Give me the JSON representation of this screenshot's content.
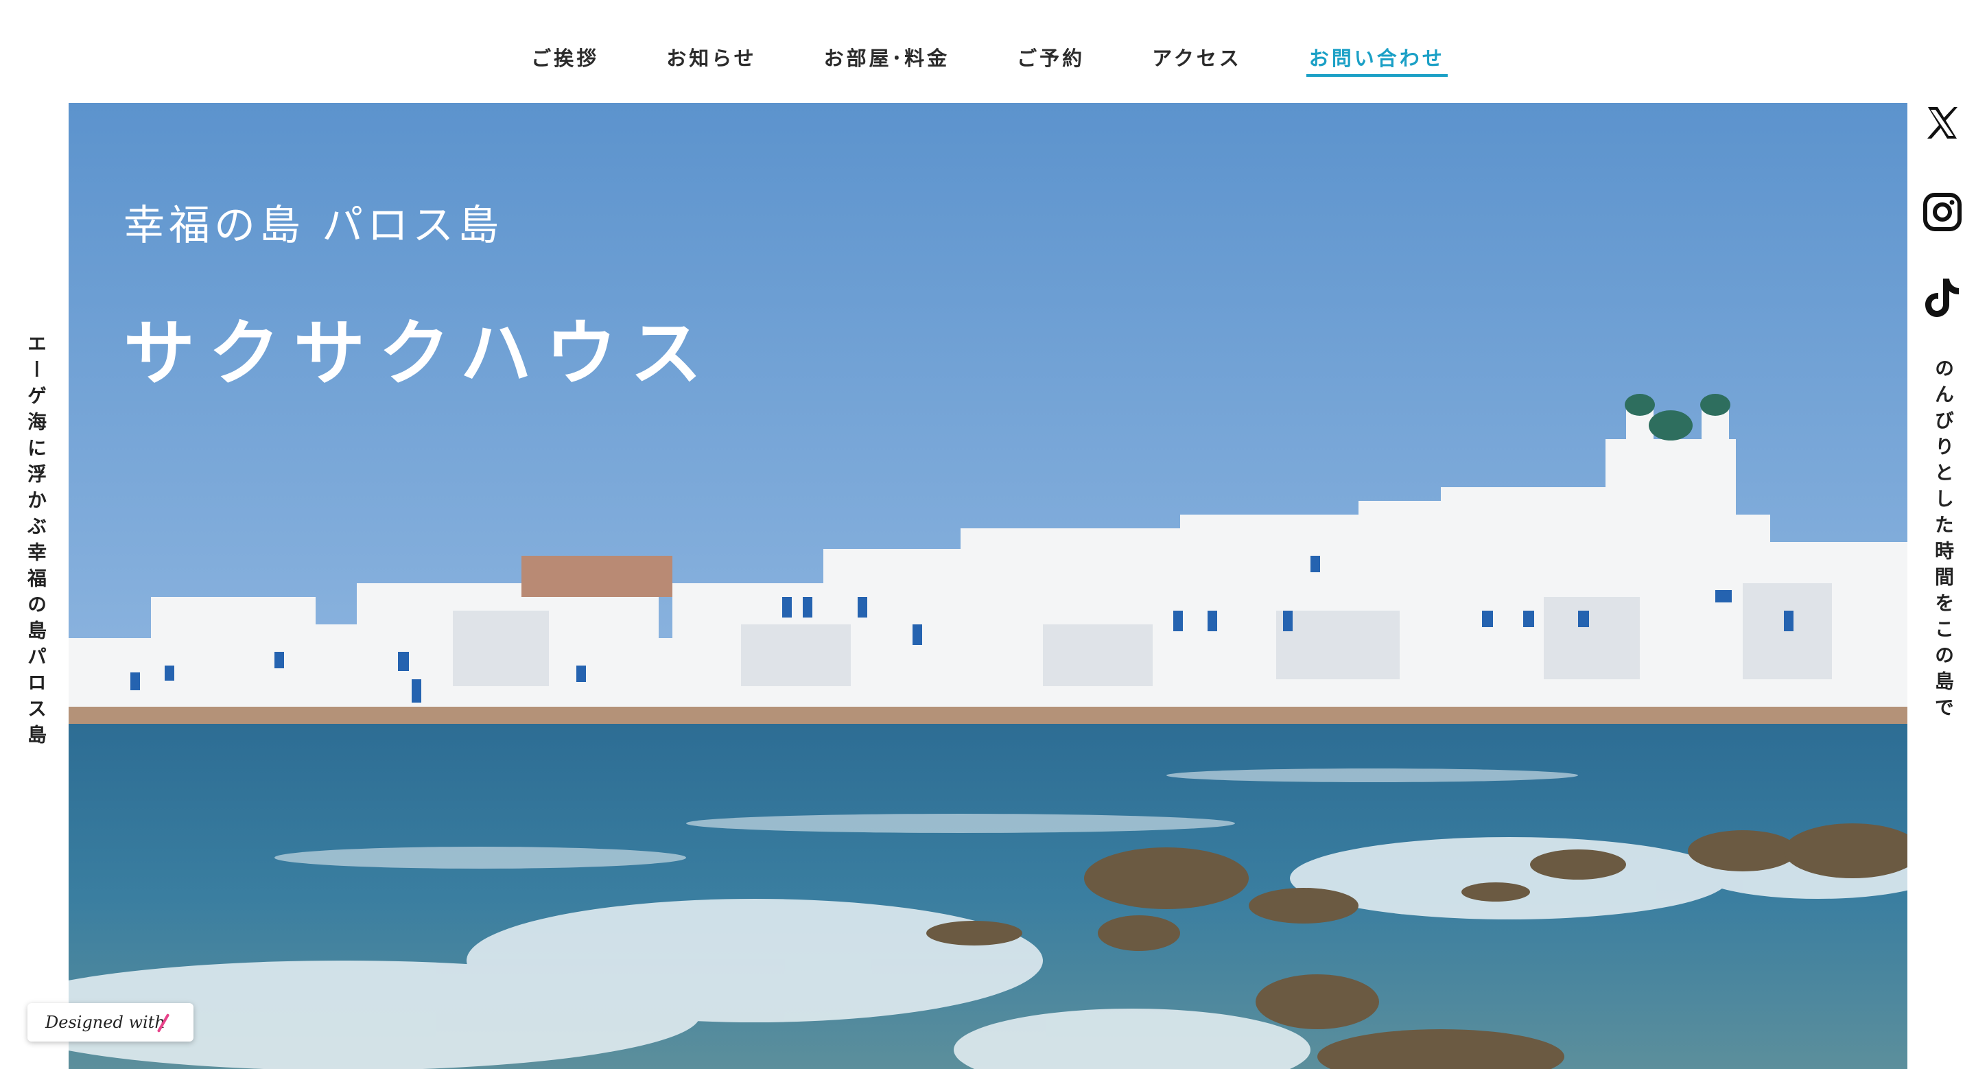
{
  "nav": {
    "items": [
      {
        "label": "ご挨拶"
      },
      {
        "label": "お知らせ"
      },
      {
        "label": "お部屋･料金"
      },
      {
        "label": "ご予約"
      },
      {
        "label": "アクセス"
      },
      {
        "label": "お問い合わせ"
      }
    ],
    "active_color": "#1ba0c6"
  },
  "hero": {
    "subtitle": "幸福の島 パロス島",
    "title": "サクサクハウス"
  },
  "side_left": "エーゲ海に浮かぶ幸福の島パロス島",
  "side_right": "のんびりとした時間をこの島で",
  "social": [
    "x-icon",
    "instagram-icon",
    "tiktok-icon"
  ],
  "badge": {
    "label": "Designed with"
  }
}
